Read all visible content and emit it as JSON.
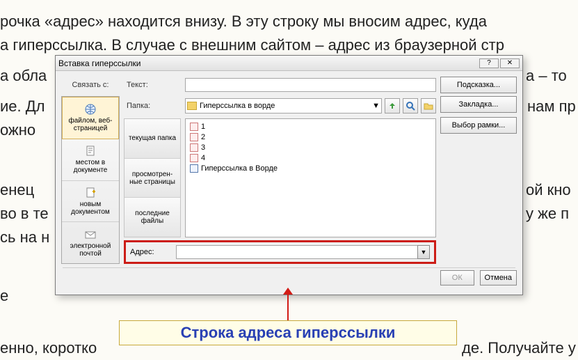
{
  "bg": {
    "l1": "рочка «адрес» находится внизу. В эту строку мы вносим адрес, куда",
    "l2": "а гиперссылка. В случае с внешним сайтом – адрес из браузерной стр",
    "l3a": "а обла",
    "l3b": "а – то",
    "l4a": "ие. Дл",
    "l4b": "нам пр",
    "l5a": "ожно",
    "l6a": "енец",
    "l6b": "ой кно",
    "l7a": "во в те",
    "l7b": "у же п",
    "l8a": "сь на н",
    "l9a": "е",
    "l10": "енно, коротко",
    "l10b": "де. Получайте у"
  },
  "dialog": {
    "title": "Вставка гиперссылки",
    "link_with": "Связать с:",
    "text_label": "Текст:",
    "text_value": "",
    "tooltip_btn": "Подсказка...",
    "folder_label": "Папка:",
    "folder_value": "Гиперссылка в ворде",
    "bookmark_btn": "Закладка...",
    "frame_btn": "Выбор рамки...",
    "addr_label": "Адрес:",
    "addr_value": "",
    "ok": "ОК",
    "cancel": "Отмена",
    "side": [
      "файлом, веб-страницей",
      "местом в документе",
      "новым документом",
      "электронной почтой"
    ],
    "tabs": [
      "текущая папка",
      "просмотрен-ные страницы",
      "последние файлы"
    ],
    "files": [
      "1",
      "2",
      "3",
      "4",
      "Гиперссылка в Ворде"
    ]
  },
  "callout": "Строка адреса гиперссылки"
}
